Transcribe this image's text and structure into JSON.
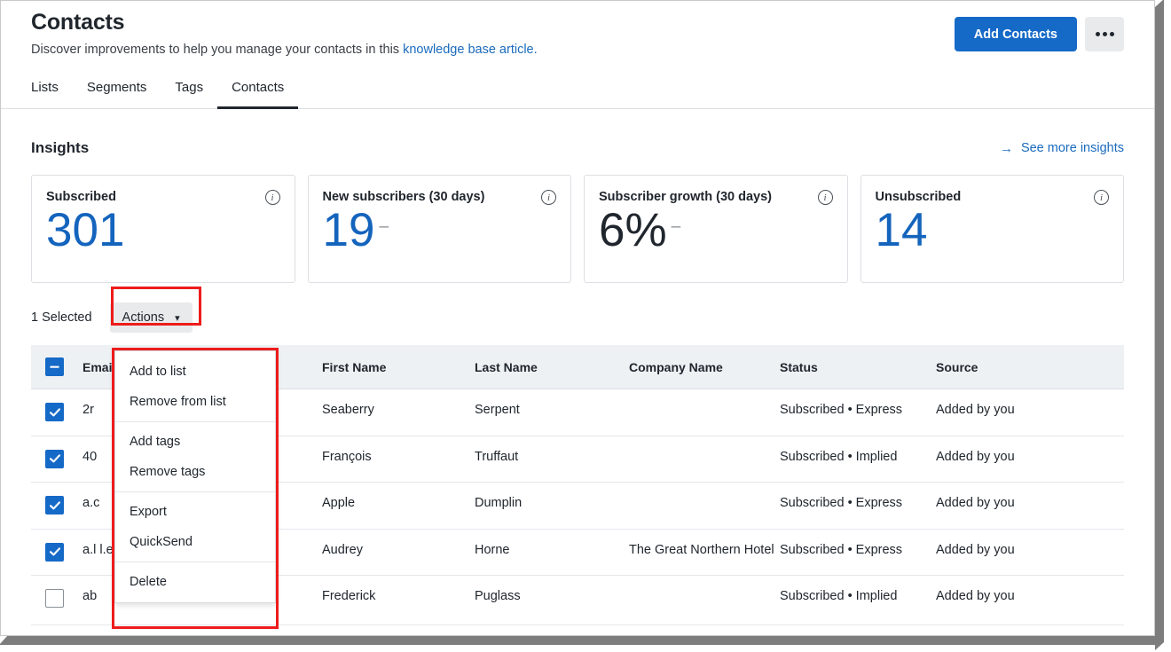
{
  "header": {
    "title": "Contacts",
    "subtitle_prefix": "Discover improvements to help you manage your contacts in this ",
    "subtitle_link": "knowledge base article.",
    "add_contacts_label": "Add Contacts",
    "overflow_icon": "more-horizontal-icon"
  },
  "tabs": [
    {
      "label": "Lists",
      "active": false
    },
    {
      "label": "Segments",
      "active": false
    },
    {
      "label": "Tags",
      "active": false
    },
    {
      "label": "Contacts",
      "active": true
    }
  ],
  "insights": {
    "title": "Insights",
    "see_more_label": "See more insights",
    "arrow_icon": "arrow-right-icon",
    "info_icon": "info-icon",
    "cards": [
      {
        "label": "Subscribed",
        "value": "301",
        "trend": "",
        "color": "#1464bd"
      },
      {
        "label": "New subscribers (30 days)",
        "value": "19",
        "trend": "–",
        "color": "#1464bd"
      },
      {
        "label": "Subscriber growth (30 days)",
        "value": "6%",
        "trend": "–",
        "color": "#20262d"
      },
      {
        "label": "Unsubscribed",
        "value": "14",
        "trend": "",
        "color": "#1464bd"
      }
    ]
  },
  "toolbar": {
    "selected_count_label": "1 Selected",
    "actions_label": "Actions",
    "chevron_icon": "chevron-down-icon"
  },
  "actions_menu": {
    "groups": [
      [
        "Add to list",
        "Remove from list"
      ],
      [
        "Add tags",
        "Remove tags"
      ],
      [
        "Export",
        "QuickSend"
      ],
      [
        "Delete"
      ]
    ]
  },
  "table": {
    "columns": [
      "",
      "Email",
      "First Name",
      "Last Name",
      "Company Name",
      "Status",
      "Source"
    ],
    "header_checkbox_state": "indeterminate",
    "rows": [
      {
        "checked": true,
        "email": "2r",
        "first_name": "Seaberry",
        "last_name": "Serpent",
        "company": "",
        "status": "Subscribed • Express",
        "source": "Added by you"
      },
      {
        "checked": true,
        "email": "40",
        "first_name": "François",
        "last_name": "Truffaut",
        "company": "",
        "status": "Subscribed • Implied",
        "source": "Added by you"
      },
      {
        "checked": true,
        "email": "a.c",
        "first_name": "Apple",
        "last_name": "Dumplin",
        "company": "",
        "status": "Subscribed • Express",
        "source": "Added by you"
      },
      {
        "checked": true,
        "email": "a.l                    l.edu",
        "first_name": "Audrey",
        "last_name": "Horne",
        "company": "The Great Northern Hotel",
        "status": "Subscribed • Express",
        "source": "Added by you"
      },
      {
        "checked": false,
        "email": "ab",
        "first_name": "Frederick",
        "last_name": "Puglass",
        "company": "",
        "status": "Subscribed • Implied",
        "source": "Added by you"
      }
    ]
  },
  "colors": {
    "accent_blue": "#1569c7",
    "link_blue": "#1a6bbd",
    "value_blue": "#1464bd",
    "highlight_red": "#ee1c1c",
    "header_bg": "#eef1f4",
    "button_grey": "#e9eaec"
  }
}
